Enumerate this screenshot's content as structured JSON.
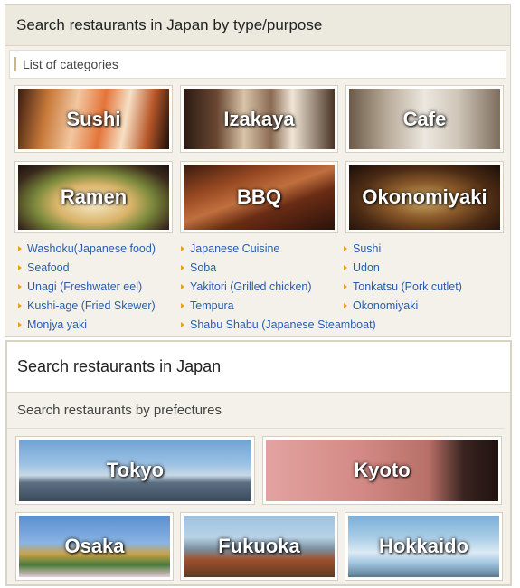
{
  "type_panel": {
    "title": "Search restaurants in Japan by type/purpose",
    "subheading": "List of categories",
    "categories": [
      {
        "label": "Sushi"
      },
      {
        "label": "Izakaya"
      },
      {
        "label": "Cafe"
      },
      {
        "label": "Ramen"
      },
      {
        "label": "BBQ"
      },
      {
        "label": "Okonomiyaki"
      }
    ],
    "links": [
      "Washoku(Japanese food)",
      "Japanese Cuisine",
      "Sushi",
      "Seafood",
      "Soba",
      "Udon",
      "Unagi (Freshwater eel)",
      "Yakitori (Grilled chicken)",
      "Tonkatsu (Pork cutlet)",
      "Kushi-age (Fried Skewer)",
      "Tempura",
      "Okonomiyaki",
      "Monjya yaki",
      "Shabu Shabu (Japanese Steamboat)"
    ]
  },
  "region_panel": {
    "title": "Search restaurants in Japan",
    "subheading": "Search restaurants by prefectures",
    "prefectures": [
      {
        "label": "Tokyo"
      },
      {
        "label": "Kyoto"
      },
      {
        "label": "Osaka"
      },
      {
        "label": "Fukuoka"
      },
      {
        "label": "Hokkaido"
      }
    ]
  },
  "colors": {
    "link": "#2a5db0",
    "bullet": "#e8a21a",
    "panel_bg": "#f3f1e9"
  }
}
